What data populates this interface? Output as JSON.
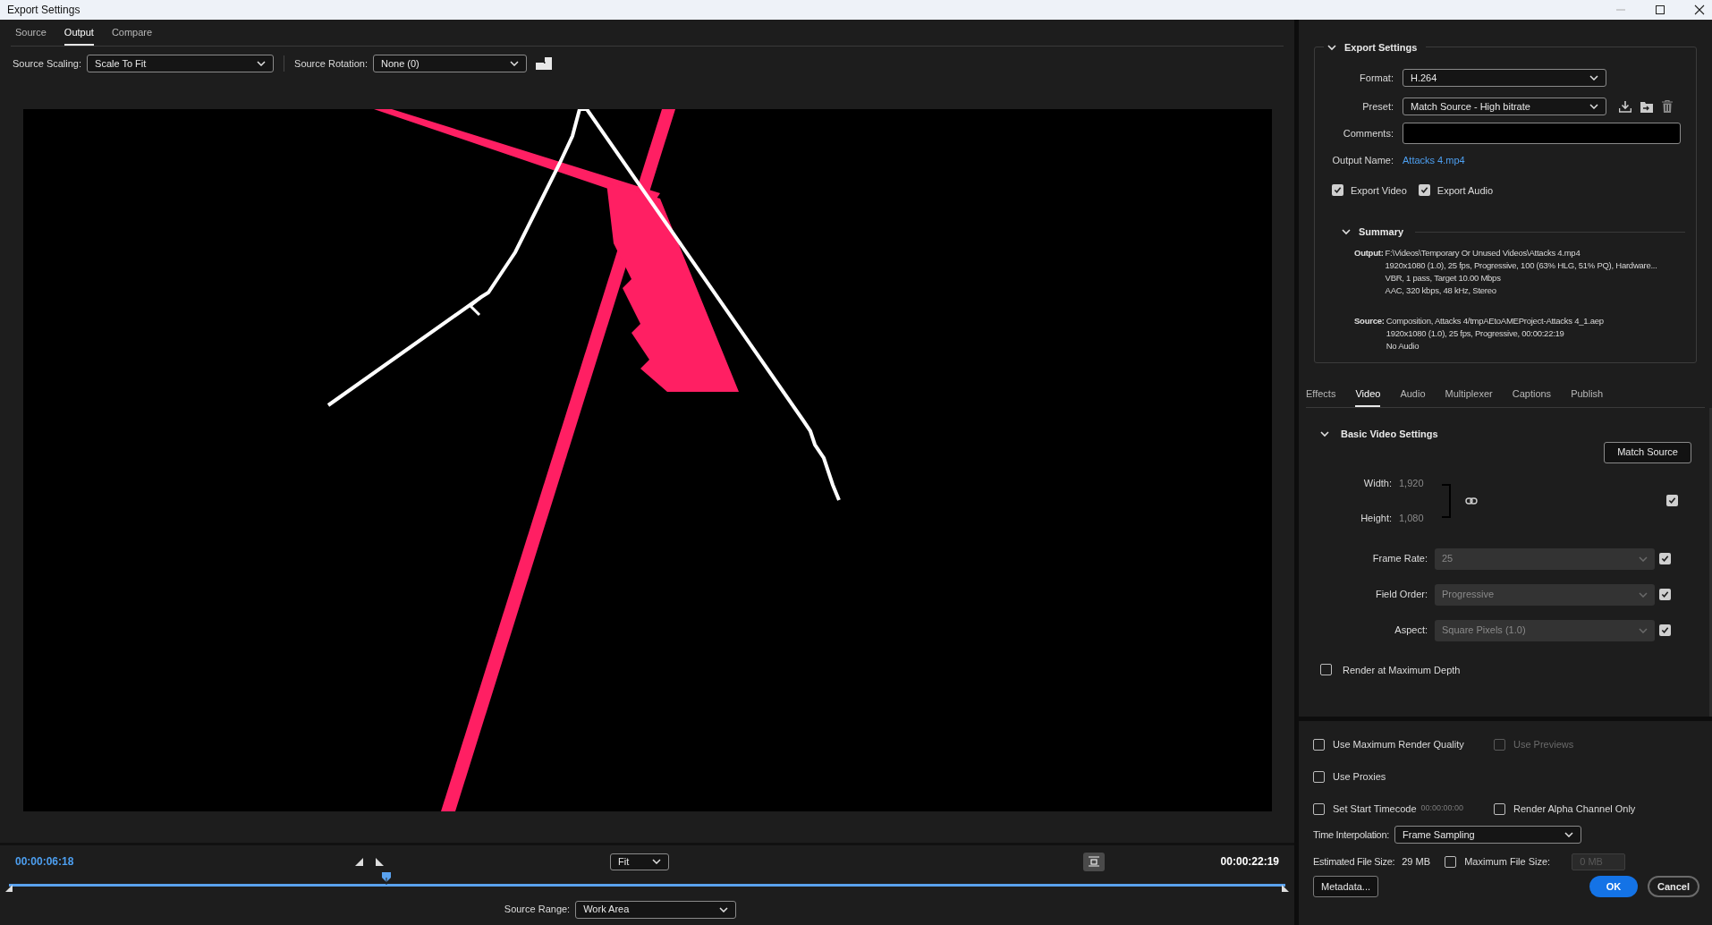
{
  "window": {
    "title": "Export Settings"
  },
  "source_tabs": [
    {
      "label": "Source",
      "selected": false
    },
    {
      "label": "Output",
      "selected": true
    },
    {
      "label": "Compare",
      "selected": false
    }
  ],
  "source_scaling": {
    "label": "Source Scaling:",
    "value": "Scale To Fit"
  },
  "source_rotation": {
    "label": "Source Rotation:",
    "value": "None (0)"
  },
  "preview": {
    "kind": "picture"
  },
  "timeline": {
    "current_time": "00:00:06:18",
    "zoom": "Fit",
    "end_time": "00:00:22:19",
    "playhead": {
      "level": 0.296
    }
  },
  "source_range": {
    "label": "Source Range:",
    "value": "Work Area"
  },
  "export_settings": {
    "title": "Export Settings",
    "expanded": true,
    "format": {
      "label": "Format:",
      "value": "H.264"
    },
    "preset": {
      "label": "Preset:",
      "value": "Match Source - High bitrate"
    },
    "comments": {
      "label": "Comments:"
    },
    "output_name": {
      "label": "Output Name:",
      "value": "Attacks 4.mp4"
    },
    "options": [
      {
        "label": "Export Video",
        "checked": true
      },
      {
        "label": "Export Audio",
        "checked": true
      }
    ],
    "summary": {
      "title": "Summary",
      "expanded": true,
      "sections": [
        {
          "label": "Output:",
          "lines": [
            "F:\\Videos\\Temporary Or Unused Videos\\Attacks 4.mp4",
            "1920x1080 (1.0), 25 fps, Progressive, 100 (63% HLG, 51% PQ), Hardware...",
            "VBR, 1 pass, Target 10.00 Mbps",
            "AAC, 320 kbps, 48 kHz, Stereo"
          ]
        },
        {
          "label": "Source:",
          "lines": [
            "Composition, Attacks 4/tmpAEtoAMEProject-Attacks 4_1.aep",
            "1920x1080 (1.0), 25 fps, Progressive, 00:00:22:19",
            "No Audio"
          ]
        }
      ]
    }
  },
  "settings_tabs": [
    {
      "label": "Effects",
      "selected": false
    },
    {
      "label": "Video",
      "selected": true
    },
    {
      "label": "Audio",
      "selected": false
    },
    {
      "label": "Multiplexer",
      "selected": false
    },
    {
      "label": "Captions",
      "selected": false
    },
    {
      "label": "Publish",
      "selected": false
    }
  ],
  "basic_video": {
    "title": "Basic Video Settings",
    "expanded": true,
    "match_source": "Match Source",
    "width": {
      "label": "Width:",
      "value": "1,920"
    },
    "height": {
      "label": "Height:",
      "value": "1,080"
    },
    "size_checked": true,
    "fields": [
      {
        "label": "Frame Rate:",
        "value": "25",
        "checked": true
      },
      {
        "label": "Field Order:",
        "value": "Progressive",
        "checked": true
      },
      {
        "label": "Aspect:",
        "value": "Square Pixels (1.0)",
        "checked": true
      }
    ],
    "max_depth": {
      "label": "Render at Maximum Depth",
      "checked": false
    }
  },
  "render_options": [
    [
      {
        "label": "Use Maximum Render Quality",
        "checked": false,
        "disabled": false
      },
      {
        "label": "Use Previews",
        "checked": false,
        "disabled": true
      }
    ],
    [
      {
        "label": "Use Proxies",
        "checked": false,
        "disabled": false
      }
    ],
    [
      {
        "label": "Set Start Timecode",
        "checked": false,
        "disabled": false,
        "value": "00:00:00:00"
      },
      {
        "label": "Render Alpha Channel Only",
        "checked": false,
        "disabled": false
      }
    ]
  ],
  "time_interpolation": {
    "label": "Time Interpolation:",
    "value": "Frame Sampling"
  },
  "estimated_size": {
    "label": "Estimated File Size:",
    "value": "29 MB"
  },
  "max_file_size": {
    "label": "Maximum File Size:",
    "checked": false,
    "placeholder": "0 MB"
  },
  "buttons": [
    {
      "label": "Metadata...",
      "kind": "secondary"
    },
    {
      "label": "OK",
      "kind": "primary"
    },
    {
      "label": "Cancel",
      "kind": "cancel"
    }
  ]
}
